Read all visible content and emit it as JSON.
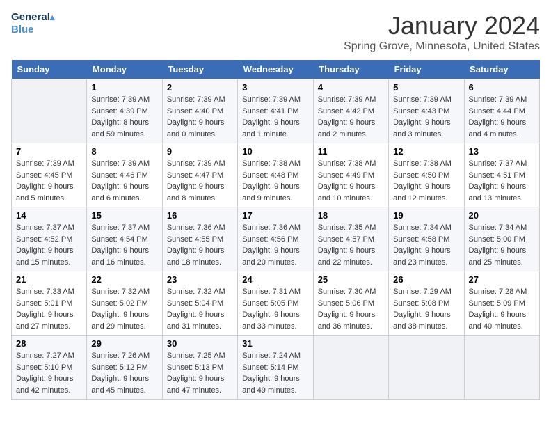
{
  "header": {
    "logo_line1": "General",
    "logo_line2": "Blue",
    "title": "January 2024",
    "subtitle": "Spring Grove, Minnesota, United States"
  },
  "weekdays": [
    "Sunday",
    "Monday",
    "Tuesday",
    "Wednesday",
    "Thursday",
    "Friday",
    "Saturday"
  ],
  "weeks": [
    [
      {
        "num": "",
        "info": ""
      },
      {
        "num": "1",
        "info": "Sunrise: 7:39 AM\nSunset: 4:39 PM\nDaylight: 8 hours\nand 59 minutes."
      },
      {
        "num": "2",
        "info": "Sunrise: 7:39 AM\nSunset: 4:40 PM\nDaylight: 9 hours\nand 0 minutes."
      },
      {
        "num": "3",
        "info": "Sunrise: 7:39 AM\nSunset: 4:41 PM\nDaylight: 9 hours\nand 1 minute."
      },
      {
        "num": "4",
        "info": "Sunrise: 7:39 AM\nSunset: 4:42 PM\nDaylight: 9 hours\nand 2 minutes."
      },
      {
        "num": "5",
        "info": "Sunrise: 7:39 AM\nSunset: 4:43 PM\nDaylight: 9 hours\nand 3 minutes."
      },
      {
        "num": "6",
        "info": "Sunrise: 7:39 AM\nSunset: 4:44 PM\nDaylight: 9 hours\nand 4 minutes."
      }
    ],
    [
      {
        "num": "7",
        "info": "Sunrise: 7:39 AM\nSunset: 4:45 PM\nDaylight: 9 hours\nand 5 minutes."
      },
      {
        "num": "8",
        "info": "Sunrise: 7:39 AM\nSunset: 4:46 PM\nDaylight: 9 hours\nand 6 minutes."
      },
      {
        "num": "9",
        "info": "Sunrise: 7:39 AM\nSunset: 4:47 PM\nDaylight: 9 hours\nand 8 minutes."
      },
      {
        "num": "10",
        "info": "Sunrise: 7:38 AM\nSunset: 4:48 PM\nDaylight: 9 hours\nand 9 minutes."
      },
      {
        "num": "11",
        "info": "Sunrise: 7:38 AM\nSunset: 4:49 PM\nDaylight: 9 hours\nand 10 minutes."
      },
      {
        "num": "12",
        "info": "Sunrise: 7:38 AM\nSunset: 4:50 PM\nDaylight: 9 hours\nand 12 minutes."
      },
      {
        "num": "13",
        "info": "Sunrise: 7:37 AM\nSunset: 4:51 PM\nDaylight: 9 hours\nand 13 minutes."
      }
    ],
    [
      {
        "num": "14",
        "info": "Sunrise: 7:37 AM\nSunset: 4:52 PM\nDaylight: 9 hours\nand 15 minutes."
      },
      {
        "num": "15",
        "info": "Sunrise: 7:37 AM\nSunset: 4:54 PM\nDaylight: 9 hours\nand 16 minutes."
      },
      {
        "num": "16",
        "info": "Sunrise: 7:36 AM\nSunset: 4:55 PM\nDaylight: 9 hours\nand 18 minutes."
      },
      {
        "num": "17",
        "info": "Sunrise: 7:36 AM\nSunset: 4:56 PM\nDaylight: 9 hours\nand 20 minutes."
      },
      {
        "num": "18",
        "info": "Sunrise: 7:35 AM\nSunset: 4:57 PM\nDaylight: 9 hours\nand 22 minutes."
      },
      {
        "num": "19",
        "info": "Sunrise: 7:34 AM\nSunset: 4:58 PM\nDaylight: 9 hours\nand 23 minutes."
      },
      {
        "num": "20",
        "info": "Sunrise: 7:34 AM\nSunset: 5:00 PM\nDaylight: 9 hours\nand 25 minutes."
      }
    ],
    [
      {
        "num": "21",
        "info": "Sunrise: 7:33 AM\nSunset: 5:01 PM\nDaylight: 9 hours\nand 27 minutes."
      },
      {
        "num": "22",
        "info": "Sunrise: 7:32 AM\nSunset: 5:02 PM\nDaylight: 9 hours\nand 29 minutes."
      },
      {
        "num": "23",
        "info": "Sunrise: 7:32 AM\nSunset: 5:04 PM\nDaylight: 9 hours\nand 31 minutes."
      },
      {
        "num": "24",
        "info": "Sunrise: 7:31 AM\nSunset: 5:05 PM\nDaylight: 9 hours\nand 33 minutes."
      },
      {
        "num": "25",
        "info": "Sunrise: 7:30 AM\nSunset: 5:06 PM\nDaylight: 9 hours\nand 36 minutes."
      },
      {
        "num": "26",
        "info": "Sunrise: 7:29 AM\nSunset: 5:08 PM\nDaylight: 9 hours\nand 38 minutes."
      },
      {
        "num": "27",
        "info": "Sunrise: 7:28 AM\nSunset: 5:09 PM\nDaylight: 9 hours\nand 40 minutes."
      }
    ],
    [
      {
        "num": "28",
        "info": "Sunrise: 7:27 AM\nSunset: 5:10 PM\nDaylight: 9 hours\nand 42 minutes."
      },
      {
        "num": "29",
        "info": "Sunrise: 7:26 AM\nSunset: 5:12 PM\nDaylight: 9 hours\nand 45 minutes."
      },
      {
        "num": "30",
        "info": "Sunrise: 7:25 AM\nSunset: 5:13 PM\nDaylight: 9 hours\nand 47 minutes."
      },
      {
        "num": "31",
        "info": "Sunrise: 7:24 AM\nSunset: 5:14 PM\nDaylight: 9 hours\nand 49 minutes."
      },
      {
        "num": "",
        "info": ""
      },
      {
        "num": "",
        "info": ""
      },
      {
        "num": "",
        "info": ""
      }
    ]
  ]
}
